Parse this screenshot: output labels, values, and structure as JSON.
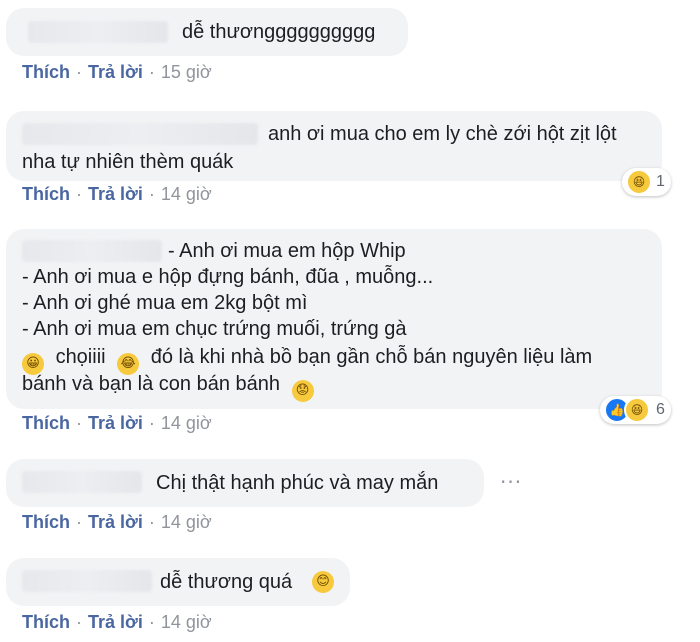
{
  "comments": [
    {
      "text": "dễ thươngggggggggg",
      "actions": {
        "like": "Thích",
        "reply": "Trả lời",
        "time": "15 giờ"
      }
    },
    {
      "lines": [
        "anh ơi mua cho em ly chè zới hột zịt lột",
        "nha tự nhiên thèm quák"
      ],
      "actions": {
        "like": "Thích",
        "reply": "Trả lời",
        "time": "14 giờ"
      },
      "reactions": {
        "icons": [
          "haha-icon"
        ],
        "count": "1"
      }
    },
    {
      "lines": [
        "- Anh ơi mua em hộp Whip",
        "- Anh ơi mua e hộp đựng bánh, đũa , muỗng...",
        "- Anh ơi ghé mua em 2kg bột mì",
        "- Anh ơi mua em chục trứng muối, trứng gà",
        "chọiiii",
        "đó là khi nhà bồ bạn gần chỗ bán nguyên liệu làm",
        "bánh và bạn là con bán bánh"
      ],
      "actions": {
        "like": "Thích",
        "reply": "Trả lời",
        "time": "14 giờ"
      },
      "reactions": {
        "icons": [
          "like-icon",
          "haha-icon"
        ],
        "count": "6"
      }
    },
    {
      "text": "Chị thật hạnh phúc và may mắn",
      "actions": {
        "like": "Thích",
        "reply": "Trả lời",
        "time": "14 giờ"
      },
      "more": "···"
    },
    {
      "text": "dễ thương quá",
      "actions": {
        "like": "Thích",
        "reply": "Trả lời",
        "time": "14 giờ"
      }
    }
  ],
  "colors": {
    "bubble": "#f2f3f5",
    "link": "#4b67a1",
    "meta": "#90949c"
  }
}
